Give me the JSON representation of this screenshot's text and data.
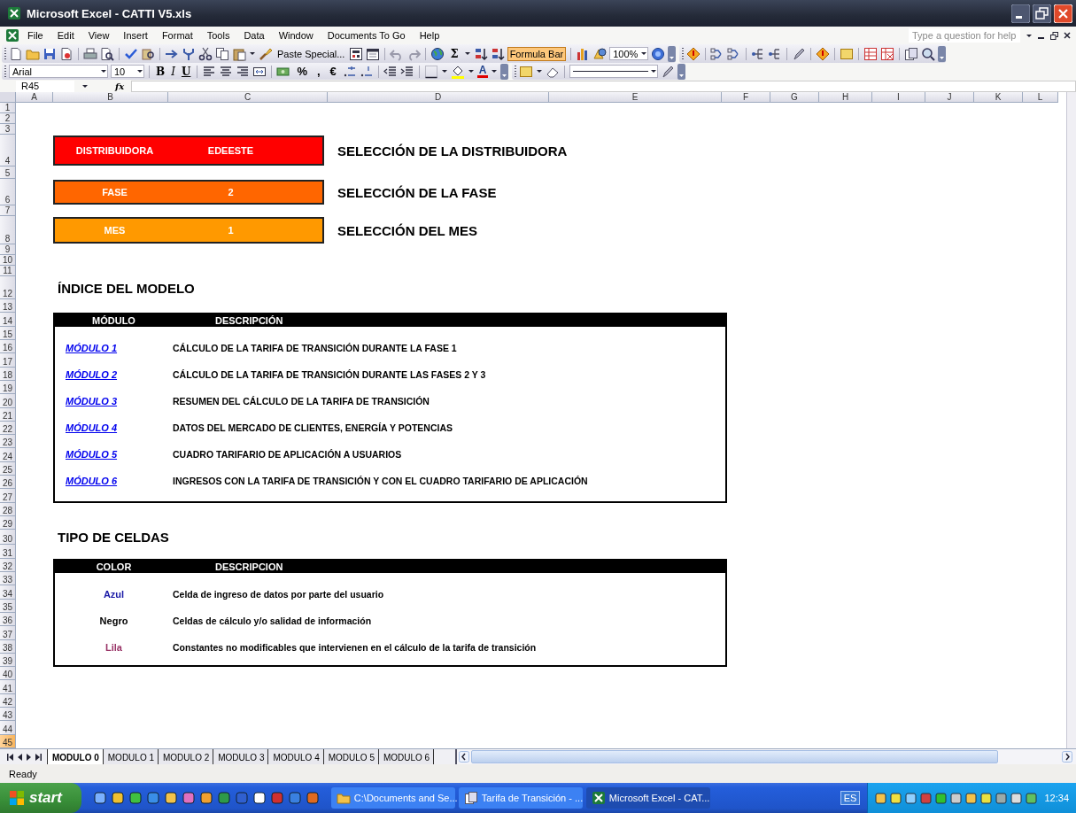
{
  "window": {
    "title": "Microsoft Excel - CATTI V5.xls"
  },
  "menu": [
    "File",
    "Edit",
    "View",
    "Insert",
    "Format",
    "Tools",
    "Data",
    "Window",
    "Documents To Go",
    "Help"
  ],
  "help_search": {
    "placeholder": "Type a question for help"
  },
  "standard_toolbar": {
    "paste_special": "Paste Special...",
    "autosum": "Σ",
    "formula_bar": {
      "label": "Formula Bar",
      "on": true
    },
    "zoom": "100%"
  },
  "formatting_toolbar": {
    "font": "Arial",
    "size": "10",
    "style_buttons": [
      {
        "label": "B",
        "kind": "bold"
      },
      {
        "label": "I",
        "kind": "italic"
      },
      {
        "label": "U",
        "kind": "underline"
      }
    ],
    "number_buttons": [
      "%",
      ",",
      "€"
    ],
    "font_color": "A"
  },
  "formula_bar": {
    "name_box": "R45",
    "fx": "fx"
  },
  "column_headers": [
    "A",
    "B",
    "C",
    "D",
    "E",
    "F",
    "G",
    "H",
    "I",
    "J",
    "K",
    "L"
  ],
  "row_headers": [
    {
      "label": "1",
      "selected": false
    },
    {
      "label": "2",
      "selected": false
    },
    {
      "label": "3",
      "selected": false
    },
    {
      "label": "4",
      "selected": false
    },
    {
      "label": "5",
      "selected": false
    },
    {
      "label": "6",
      "selected": false
    },
    {
      "label": "7",
      "selected": false
    },
    {
      "label": "8",
      "selected": false
    },
    {
      "label": "9",
      "selected": false
    },
    {
      "label": "10",
      "selected": false
    },
    {
      "label": "11",
      "selected": false
    },
    {
      "label": "12",
      "selected": false
    },
    {
      "label": "13",
      "selected": false
    },
    {
      "label": "14",
      "selected": false
    },
    {
      "label": "15",
      "selected": false
    },
    {
      "label": "16",
      "selected": false
    },
    {
      "label": "17",
      "selected": false
    },
    {
      "label": "18",
      "selected": false
    },
    {
      "label": "19",
      "selected": false
    },
    {
      "label": "20",
      "selected": false
    },
    {
      "label": "21",
      "selected": false
    },
    {
      "label": "22",
      "selected": false
    },
    {
      "label": "23",
      "selected": false
    },
    {
      "label": "24",
      "selected": false
    },
    {
      "label": "25",
      "selected": false
    },
    {
      "label": "26",
      "selected": false
    },
    {
      "label": "27",
      "selected": false
    },
    {
      "label": "28",
      "selected": false
    },
    {
      "label": "29",
      "selected": false
    },
    {
      "label": "30",
      "selected": false
    },
    {
      "label": "31",
      "selected": false
    },
    {
      "label": "32",
      "selected": false
    },
    {
      "label": "33",
      "selected": false
    },
    {
      "label": "34",
      "selected": false
    },
    {
      "label": "35",
      "selected": false
    },
    {
      "label": "36",
      "selected": false
    },
    {
      "label": "37",
      "selected": false
    },
    {
      "label": "38",
      "selected": false
    },
    {
      "label": "39",
      "selected": false
    },
    {
      "label": "40",
      "selected": false
    },
    {
      "label": "41",
      "selected": false
    },
    {
      "label": "42",
      "selected": false
    },
    {
      "label": "43",
      "selected": false
    },
    {
      "label": "44",
      "selected": false
    },
    {
      "label": "45",
      "selected": true
    }
  ],
  "selectors": [
    {
      "label": "DISTRIBUIDORA",
      "value": "EDEESTE",
      "color": "#ff0000",
      "heading": "SELECCIÓN DE LA DISTRIBUIDORA"
    },
    {
      "label": "FASE",
      "value": "2",
      "color": "#ff6600",
      "heading": "SELECCIÓN DE LA FASE"
    },
    {
      "label": "MES",
      "value": "1",
      "color": "#ff9900",
      "heading": "SELECCIÓN DEL MES"
    }
  ],
  "model_index": {
    "title": "ÍNDICE DEL MODELO",
    "columns": [
      "MÓDULO",
      "DESCRIPCIÓN"
    ],
    "rows": [
      {
        "module": "MÓDULO 1",
        "description": "CÁLCULO DE LA TARIFA DE TRANSICIÓN DURANTE LA FASE 1"
      },
      {
        "module": "MÓDULO 2",
        "description": "CÁLCULO DE LA TARIFA DE TRANSICIÓN DURANTE LAS FASES 2 Y 3"
      },
      {
        "module": "MÓDULO 3",
        "description": "RESUMEN DEL CÁLCULO DE LA TARIFA DE TRANSICIÓN"
      },
      {
        "module": "MÓDULO 4",
        "description": "DATOS DEL MERCADO DE CLIENTES, ENERGÍA Y POTENCIAS"
      },
      {
        "module": "MÓDULO 5",
        "description": "CUADRO TARIFARIO DE APLICACIÓN A USUARIOS"
      },
      {
        "module": "MÓDULO 6",
        "description": "INGRESOS CON LA TARIFA DE TRANSICIÓN Y CON EL CUADRO TARIFARIO DE APLICACIÓN"
      }
    ]
  },
  "cell_types": {
    "title": "TIPO DE CELDAS",
    "columns": [
      "COLOR",
      "DESCRIPCION"
    ],
    "rows": [
      {
        "name": "Azul",
        "color": "#1a1aa6",
        "description": "Celda de ingreso de datos  por parte del usuario"
      },
      {
        "name": "Negro",
        "color": "#000000",
        "description": "Celdas de cálculo y/o salidad de información"
      },
      {
        "name": "Lila",
        "color": "#993366",
        "description": "Constantes no modificables que intervienen en el cálculo de la tarifa de transición"
      }
    ]
  },
  "sheet_tabs": [
    {
      "label": "MODULO 0",
      "selected": true
    },
    {
      "label": "MODULO 1",
      "selected": false
    },
    {
      "label": "MODULO 2",
      "selected": false
    },
    {
      "label": "MODULO 3",
      "selected": false
    },
    {
      "label": "MODULO 4",
      "selected": false
    },
    {
      "label": "MODULO 5",
      "selected": false
    },
    {
      "label": "MODULO 6",
      "selected": false
    }
  ],
  "status_bar": "Ready",
  "taskbar": {
    "start": "start",
    "tasks": [
      {
        "label": "C:\\Documents and Se...",
        "selected": false
      },
      {
        "label": "Tarifa de Transición - ...",
        "selected": false
      },
      {
        "label": "Microsoft Excel - CAT...",
        "selected": true
      }
    ],
    "language": "ES",
    "clock": "12:34"
  }
}
